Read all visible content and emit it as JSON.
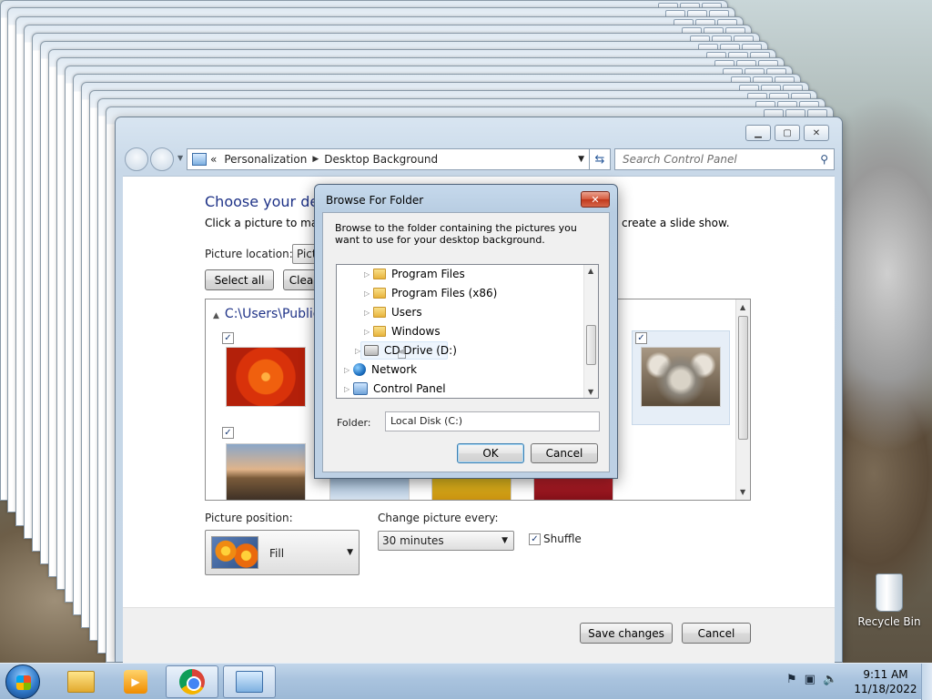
{
  "window": {
    "breadcrumb_prefix": "«",
    "breadcrumb": [
      "Personalization",
      "Desktop Background"
    ],
    "search_placeholder": "Search Control Panel",
    "heading": "Choose your desk",
    "description": "Click a picture to make",
    "description_tail": "create a slide show.",
    "picture_location_label": "Picture location:",
    "picture_location_value": "Pict",
    "select_all": "Select all",
    "clear_all": "Clea",
    "gallery_path": "C:\\Users\\Public",
    "picture_position_label": "Picture position:",
    "picture_position_value": "Fill",
    "change_every_label": "Change picture every:",
    "change_every_value": "30 minutes",
    "shuffle_label": "Shuffle",
    "shuffle_checked": true,
    "save_changes": "Save changes",
    "cancel": "Cancel"
  },
  "dialog": {
    "title": "Browse For Folder",
    "description": "Browse to the folder containing the pictures you want to use for your desktop background.",
    "tree": [
      {
        "label": "Program Files",
        "icon": "folder-icon"
      },
      {
        "label": "Program Files (x86)",
        "icon": "folder-icon"
      },
      {
        "label": "Users",
        "icon": "folder-icon"
      },
      {
        "label": "Windows",
        "icon": "folder-icon"
      },
      {
        "label": "CD Drive (D:)",
        "icon": "cd-drive-icon"
      },
      {
        "label": "Network",
        "icon": "network-icon"
      },
      {
        "label": "Control Panel",
        "icon": "control-panel-icon"
      }
    ],
    "folder_label": "Folder:",
    "folder_value": "Local Disk (C:)",
    "ok": "OK",
    "cancel": "Cancel"
  },
  "desktop": {
    "recycle_bin": "Recycle Bin"
  },
  "taskbar": {
    "time": "9:11 AM",
    "date": "11/18/2022"
  }
}
